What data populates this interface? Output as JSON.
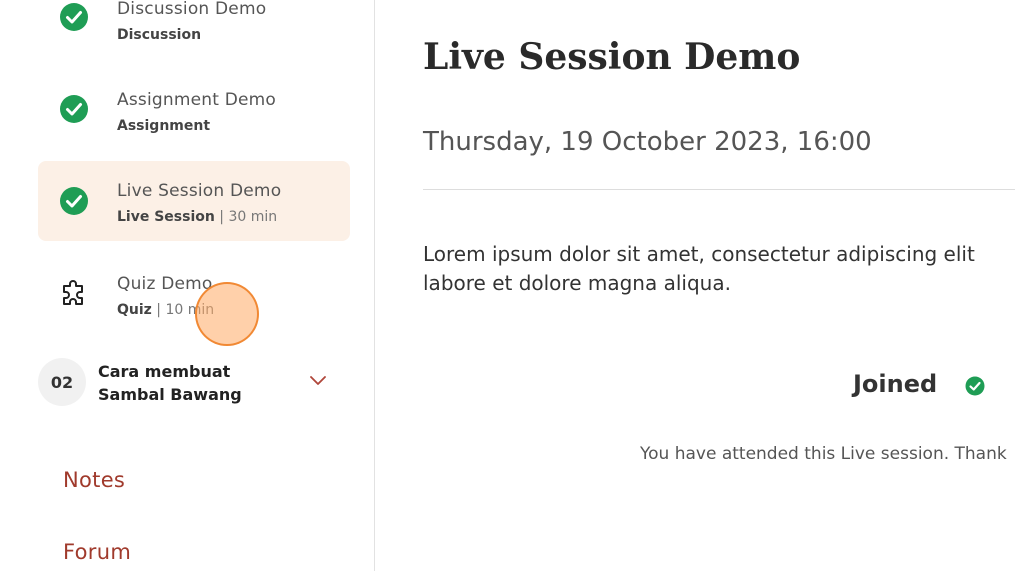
{
  "sidebar": {
    "lessons": [
      {
        "title": "Discussion Demo",
        "type": "Discussion",
        "duration": "",
        "status": "completed"
      },
      {
        "title": "Assignment Demo",
        "type": "Assignment",
        "duration": "",
        "status": "completed"
      },
      {
        "title": "Live Session Demo",
        "type": "Live Session",
        "duration": "| 30 min",
        "status": "completed"
      },
      {
        "title": "Quiz Demo",
        "type": "Quiz",
        "duration": "| 10 min",
        "status": "quiz"
      }
    ],
    "section": {
      "number": "02",
      "title": "Cara membuat Sambal Bawang",
      "icon": "chevron-down-icon"
    },
    "links": {
      "notes": "Notes",
      "forum": "Forum"
    }
  },
  "main": {
    "title": "Live Session Demo",
    "date": "Thursday, 19 October 2023, 16:00",
    "description_line1": "Lorem ipsum dolor sit amet, consectetur adipiscing elit",
    "description_line2": "labore et dolore magna aliqua.",
    "joined_label": "Joined",
    "attended_text": "You have attended this Live session. Thank"
  },
  "colors": {
    "check_green": "#1f9d55",
    "active_bg": "#fcf0e6",
    "link_red": "#a03a2c",
    "chevron_red": "#b0463a"
  }
}
